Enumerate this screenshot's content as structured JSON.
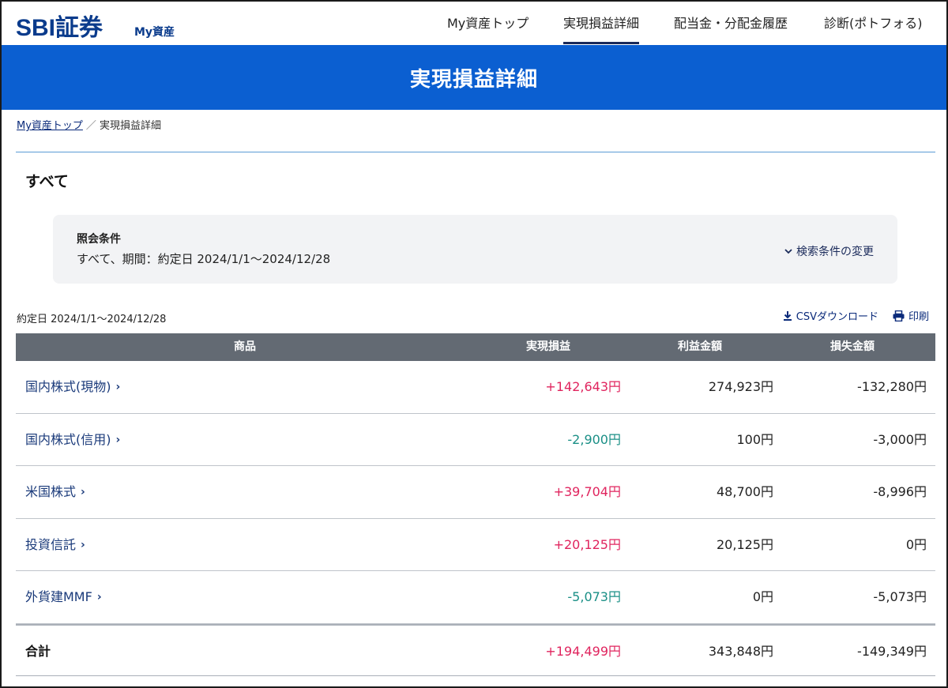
{
  "header": {
    "logo": "SBI証券",
    "logo_sub": "My資産",
    "nav": [
      {
        "label": "My資産トップ",
        "active": false
      },
      {
        "label": "実現損益詳細",
        "active": true
      },
      {
        "label": "配当金・分配金履歴",
        "active": false
      },
      {
        "label": "診断(ポトフォる)",
        "active": false
      }
    ]
  },
  "banner": {
    "title": "実現損益詳細"
  },
  "breadcrumb": {
    "home": "My資産トップ",
    "sep": "／",
    "current": "実現損益詳細"
  },
  "section_title": "すべて",
  "query": {
    "label": "照会条件",
    "value": "すべて、期間：約定日 2024/1/1〜2024/12/28",
    "change_label": "検索条件の変更"
  },
  "period_text": "約定日 2024/1/1〜2024/12/28",
  "tools": {
    "csv_label": "CSVダウンロード",
    "print_label": "印刷"
  },
  "table": {
    "headers": {
      "product": "商品",
      "pl": "実現損益",
      "gain": "利益金額",
      "loss": "損失金額"
    },
    "rows": [
      {
        "name": "国内株式(現物)",
        "pl": "+142,643円",
        "gain": "274,923円",
        "loss": "-132,280円"
      },
      {
        "name": "国内株式(信用)",
        "pl": "-2,900円",
        "gain": "100円",
        "loss": "-3,000円"
      },
      {
        "name": "米国株式",
        "pl": "+39,704円",
        "gain": "48,700円",
        "loss": "-8,996円"
      },
      {
        "name": "投資信託",
        "pl": "+20,125円",
        "gain": "20,125円",
        "loss": "0円"
      },
      {
        "name": "外貨建MMF",
        "pl": "-5,073円",
        "gain": "0円",
        "loss": "-5,073円"
      }
    ],
    "total": {
      "name": "合計",
      "pl": "+194,499円",
      "gain": "343,848円",
      "loss": "-149,349円"
    }
  },
  "colors": {
    "banner": "#0b5fd1",
    "positive": "#e0245e",
    "negative": "#1a8f86",
    "table_header": "#636a73"
  }
}
